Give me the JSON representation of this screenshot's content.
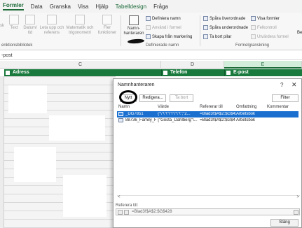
{
  "ribbon_tabs": [
    {
      "label": "Formler"
    },
    {
      "label": "Data"
    },
    {
      "label": "Granska"
    },
    {
      "label": "Visa"
    },
    {
      "label": "Hjälp"
    },
    {
      "label": "Tabelldesign"
    },
    {
      "label": "Fråga"
    }
  ],
  "ribbon": {
    "btn_lookup_partial": "sk",
    "btn_text_1": "Text",
    "btn_text_2": "",
    "btn_datetime_1": "Datum/",
    "btn_datetime_2": "tid",
    "btn_lookup_1": "Leta upp och",
    "btn_lookup_2": "referens",
    "btn_math_1": "Matematik och",
    "btn_math_2": "trigonometri",
    "btn_more_1": "Fler",
    "btn_more_2": "funktioner",
    "group_library": "enktionsbibliotek",
    "btn_name_manager_1": "Namn-",
    "btn_name_manager_2": "hanteraren",
    "define_name": "Definiera namn",
    "use_in_formula": "Använd i formel",
    "create_from_selection": "Skapa från markering",
    "group_defined_names": "Definierade namn",
    "trace_precedents": "Spåra överordnade",
    "trace_dependents": "Spåra underordnade",
    "remove_arrows": "Ta bort pilar",
    "show_formulas": "Visa formler",
    "error_checking": "Felkontroll",
    "evaluate_formula": "Utvärdera formel",
    "group_auditing": "Formelgranskning",
    "edge_cut": "Be"
  },
  "formula_bar": {
    "value": "-post"
  },
  "columns": {
    "c": "C",
    "d": "D",
    "e": "E"
  },
  "table_headers": {
    "address": "Adress",
    "phone": "Telefon",
    "email": "E-post"
  },
  "dialog": {
    "title": "Namnhanteraren",
    "help": "?",
    "close_x": "✕",
    "btn_new": "Nytt",
    "btn_edit": "Redigera...",
    "btn_delete": "Ta bort",
    "btn_filter": "Filter",
    "col_name": "Namn",
    "col_value": "Värde",
    "col_refers": "Refererar till",
    "col_scope": "Omfattning",
    "col_comment": "Kommentar",
    "rows": [
      {
        "name": "_DG7851",
        "value": "{\"\\\"\\\"\\\"\\\"\\\"\\\"\\\"\\\";\"2...",
        "refers": "=Blad3!$A$2:$G$428",
        "scope": "Arbetsbok",
        "comment": ""
      },
      {
        "name": "88736_Family_Fi...",
        "value": "{\"Gösta_Dahlberg\"\\...",
        "refers": "=Blad3!$A$2:$G$47...",
        "scope": "Arbetsbok",
        "comment": ""
      }
    ],
    "scroll_left": "<",
    "scroll_right": ">",
    "refers_label": "Referera till:",
    "refers_value": "=Blad3!$A$2:$G$428",
    "btn_close": "Stäng"
  },
  "colors": {
    "accent": "#1a7a3e",
    "selection": "#1a6fcf"
  }
}
